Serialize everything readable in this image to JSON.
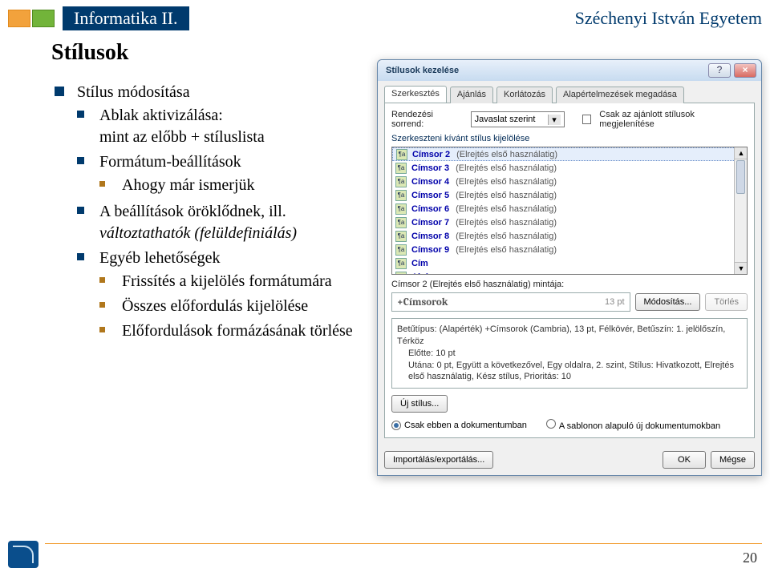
{
  "header": {
    "title_band": "Informatika II.",
    "university": "Széchenyi István Egyetem",
    "section": "Stílusok"
  },
  "outline": {
    "l1": "Stílus módosítása",
    "l2a": "Ablak aktivizálása:",
    "l2a_cont": "mint az előbb + stíluslista",
    "l2b": "Formátum-beállítások",
    "l3b1": "Ahogy már ismerjük",
    "l2c": "A beállítások öröklődnek, ill.",
    "l2c_cont": "változtathatók (felüldefiniálás)",
    "l2d": "Egyéb lehetőségek",
    "l3d1": "Frissítés a kijelölés formátumára",
    "l3d2": "Összes előfordulás kijelölése",
    "l3d3": "Előfordulások formázásának törlése"
  },
  "dialog": {
    "title": "Stílusok kezelése",
    "tabs": {
      "edit": "Szerkesztés",
      "rec": "Ajánlás",
      "restrict": "Korlátozás",
      "defaults": "Alapértelmezések megadása"
    },
    "sort_label": "Rendezési sorrend:",
    "sort_value": "Javaslat szerint",
    "only_rec": "Csak az ajánlott stílusok megjelenítése",
    "list_head": "Szerkeszteni kívánt stílus kijelölése",
    "items": [
      {
        "name": "Címsor 2",
        "note": "(Elrejtés első használatig)",
        "sel": true
      },
      {
        "name": "Címsor 3",
        "note": "(Elrejtés első használatig)"
      },
      {
        "name": "Címsor 4",
        "note": "(Elrejtés első használatig)"
      },
      {
        "name": "Címsor 5",
        "note": "(Elrejtés első használatig)"
      },
      {
        "name": "Címsor 6",
        "note": "(Elrejtés első használatig)"
      },
      {
        "name": "Címsor 7",
        "note": "(Elrejtés első használatig)"
      },
      {
        "name": "Címsor 8",
        "note": "(Elrejtés első használatig)"
      },
      {
        "name": "Címsor 9",
        "note": "(Elrejtés első használatig)"
      },
      {
        "name": "Cím",
        "note": ""
      },
      {
        "name": "Alcím",
        "note": ""
      }
    ],
    "preview_label_prefix": "Címsor 2  (Elrejtés első használatig) mintája:",
    "preview_style": "+Címsorok",
    "preview_size": "13 pt",
    "btn_modify": "Módosítás...",
    "btn_delete": "Törlés",
    "desc_l1": "Betűtípus: (Alapérték) +Címsorok (Cambria), 13 pt, Félkövér, Betűszín: 1. jelölőszín, Térköz",
    "desc_l2": "Előtte: 10 pt",
    "desc_l3": "Utána: 0 pt, Együtt a következővel, Egy oldalra, 2. szint, Stílus: Hivatkozott, Elrejtés első használatig, Kész stílus, Prioritás: 10",
    "new_style": "Új stílus...",
    "radio1": "Csak ebben a dokumentumban",
    "radio2": "A sablonon alapuló új dokumentumokban",
    "import_export": "Importálás/exportálás...",
    "ok": "OK",
    "cancel": "Mégse"
  },
  "page_number": "20"
}
